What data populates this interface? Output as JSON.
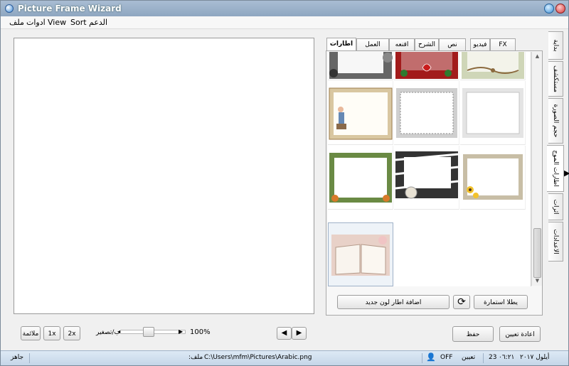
{
  "window": {
    "title": "Picture Frame Wizard"
  },
  "menu": [
    "ملف",
    "ادوات",
    "View",
    "Sort",
    "الدعم"
  ],
  "tabs": [
    "FX",
    "فيديو",
    "نص",
    "الشرح",
    "اقنعه",
    "العمل الفني",
    "اطارات"
  ],
  "active_tab": "اطارات",
  "side_tabs": [
    "بداية",
    "مستكشف",
    "حجم الصورة",
    "اطارات الموج",
    "اثرات",
    "الاعدادات"
  ],
  "active_side_tab": "اطارات الموج",
  "gallery_buttons": {
    "apply": "يطلا استمارة",
    "add_frame": "اضافة اطار لون جديد"
  },
  "zoom": {
    "fit": "ملائمة",
    "x1": "1x",
    "x2": "2x",
    "label": "ب/تصغير",
    "percent": "100%"
  },
  "action_buttons": {
    "reset": "اعادة تعيين",
    "save": "حفظ"
  },
  "status": {
    "ready": "جاهز",
    "file_label": ":ملف",
    "file_path": "C:\\Users\\mfm\\Pictures\\Arabic.png",
    "toggle": "OFF",
    "set_label": "تعيين",
    "time": "٠٦:٢١",
    "day": "23",
    "month_year": "أيلول ٢٠١٧"
  },
  "colors": {
    "titlebar": "#9db3cb",
    "status": "#cfdcea",
    "selected_thumb": "#eef3f8"
  }
}
